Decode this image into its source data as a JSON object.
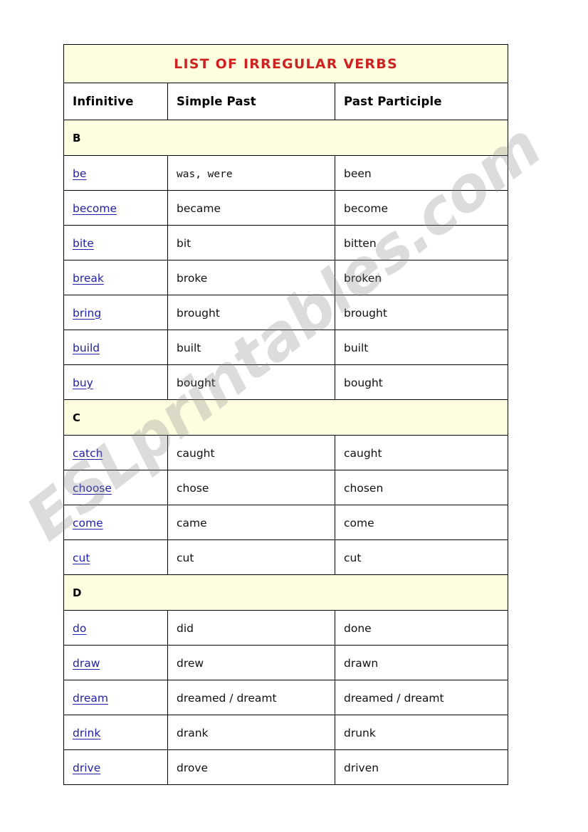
{
  "document": {
    "title": "LIST OF IRREGULAR VERBS",
    "title_color": "#cc2222",
    "header_background": "#fdfde0",
    "link_color": "#2020a8"
  },
  "watermark": {
    "text": "ESLprintables.com"
  },
  "table": {
    "columns": [
      {
        "label": "Infinitive"
      },
      {
        "label": "Simple Past"
      },
      {
        "label": "Past Participle"
      }
    ],
    "sections": [
      {
        "letter": "B",
        "rows": [
          {
            "infinitive": "be",
            "simple_past": "was, were",
            "past_participle": "been",
            "mono": true
          },
          {
            "infinitive": "become",
            "simple_past": "became",
            "past_participle": "become",
            "mono": false
          },
          {
            "infinitive": "bite",
            "simple_past": "bit",
            "past_participle": "bitten",
            "mono": false
          },
          {
            "infinitive": "break",
            "simple_past": "broke",
            "past_participle": "broken",
            "mono": false
          },
          {
            "infinitive": "bring",
            "simple_past": "brought",
            "past_participle": "brought",
            "mono": false
          },
          {
            "infinitive": "build",
            "simple_past": "built",
            "past_participle": "built",
            "mono": false
          },
          {
            "infinitive": "buy",
            "simple_past": "bought",
            "past_participle": "bought",
            "mono": false
          }
        ]
      },
      {
        "letter": "C",
        "rows": [
          {
            "infinitive": "catch",
            "simple_past": "caught",
            "past_participle": "caught",
            "mono": false
          },
          {
            "infinitive": "choose",
            "simple_past": "chose",
            "past_participle": "chosen",
            "mono": false
          },
          {
            "infinitive": "come",
            "simple_past": "came",
            "past_participle": "come",
            "mono": false
          },
          {
            "infinitive": "cut",
            "simple_past": "cut",
            "past_participle": "cut",
            "mono": false
          }
        ]
      },
      {
        "letter": "D",
        "rows": [
          {
            "infinitive": "do",
            "simple_past": "did",
            "past_participle": "done",
            "mono": false
          },
          {
            "infinitive": "draw",
            "simple_past": "drew",
            "past_participle": "drawn",
            "mono": false
          },
          {
            "infinitive": "dream",
            "simple_past": "dreamed / dreamt",
            "past_participle": "dreamed / dreamt",
            "mono": false
          },
          {
            "infinitive": "drink",
            "simple_past": "drank",
            "past_participle": "drunk",
            "mono": false
          },
          {
            "infinitive": "drive",
            "simple_past": "drove",
            "past_participle": "driven",
            "mono": false
          }
        ]
      }
    ]
  }
}
